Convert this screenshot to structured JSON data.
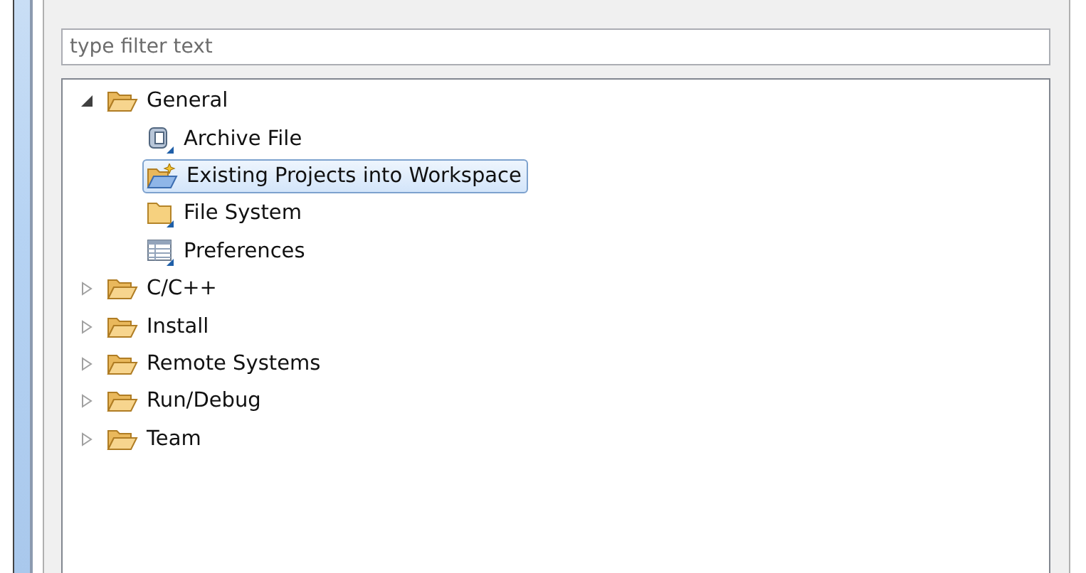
{
  "filter": {
    "placeholder": "type filter text"
  },
  "tree": [
    {
      "label": "General",
      "kind": "folder",
      "expanded": true,
      "selected": false,
      "children": [
        {
          "label": "Archive File",
          "kind": "archive",
          "selected": false
        },
        {
          "label": "Existing Projects into Workspace",
          "kind": "import",
          "selected": true
        },
        {
          "label": "File System",
          "kind": "filesystem",
          "selected": false
        },
        {
          "label": "Preferences",
          "kind": "preferences",
          "selected": false
        }
      ]
    },
    {
      "label": "C/C++",
      "kind": "folder",
      "expanded": false,
      "selected": false
    },
    {
      "label": "Install",
      "kind": "folder",
      "expanded": false,
      "selected": false
    },
    {
      "label": "Remote Systems",
      "kind": "folder",
      "expanded": false,
      "selected": false
    },
    {
      "label": "Run/Debug",
      "kind": "folder",
      "expanded": false,
      "selected": false
    },
    {
      "label": "Team",
      "kind": "folder",
      "expanded": false,
      "selected": false
    }
  ]
}
